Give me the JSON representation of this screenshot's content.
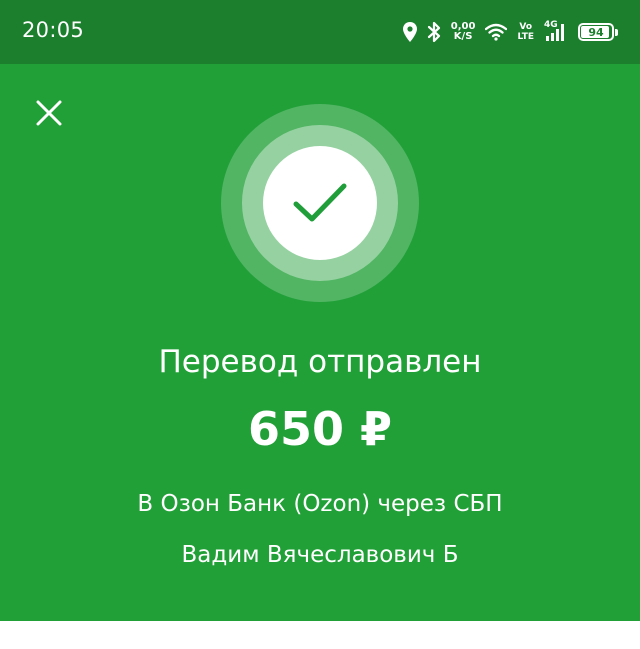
{
  "status_bar": {
    "time": "20:05",
    "net_speed_value": "0,00",
    "net_speed_unit": "K/S",
    "volte_top": "Vo",
    "volte_bottom": "LTE",
    "network_type": "4G",
    "battery_level": "94",
    "battery_fraction": 0.94,
    "icons": [
      "location-icon",
      "bluetooth-icon",
      "wifi-icon",
      "signal-icon",
      "battery-icon"
    ]
  },
  "screen": {
    "close_icon": "close-icon",
    "status_icon": "checkmark-icon",
    "title": "Перевод отправлен",
    "amount": "650 ₽",
    "bank_line": "В Озон Банк (Ozon) через СБП",
    "recipient": "Вадим Вячеславович Б"
  },
  "colors": {
    "status_bar_bg": "#1c7f2e",
    "panel_bg": "#21a038",
    "check_color": "#1f9e39",
    "text": "#ffffff"
  }
}
